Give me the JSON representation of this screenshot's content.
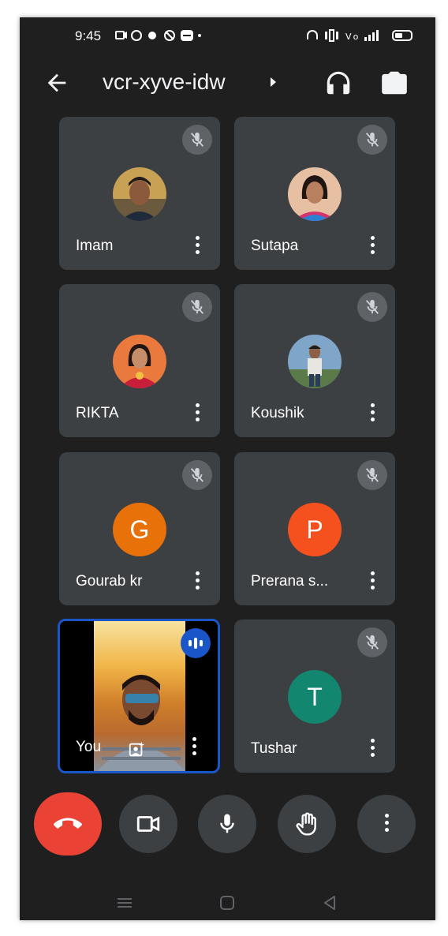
{
  "status_bar": {
    "time": "9:45"
  },
  "app_bar": {
    "meeting_code": "vcr-xyve-idw"
  },
  "participants": [
    {
      "name": "Imam",
      "muted": true,
      "avatar_type": "photo"
    },
    {
      "name": "Sutapa",
      "muted": true,
      "avatar_type": "photo"
    },
    {
      "name": "RIKTA",
      "muted": true,
      "avatar_type": "photo"
    },
    {
      "name": "Koushik",
      "muted": true,
      "avatar_type": "photo"
    },
    {
      "name": "Gourab kr",
      "muted": true,
      "avatar_type": "letter",
      "letter": "G",
      "color": "#e8710a"
    },
    {
      "name": "Prerana s...",
      "muted": true,
      "avatar_type": "letter",
      "letter": "P",
      "color": "#f4511e"
    },
    {
      "name": "You",
      "muted": false,
      "speaking": true,
      "avatar_type": "video"
    },
    {
      "name": "Tushar",
      "muted": true,
      "avatar_type": "letter",
      "letter": "T",
      "color": "#12866f"
    }
  ],
  "colors": {
    "background": "#1f1f20",
    "tile": "#3c4043",
    "hangup": "#ea4335",
    "active_speaker": "#1a56c8"
  },
  "controls": [
    "hang-up",
    "camera",
    "microphone",
    "raise-hand",
    "more-options"
  ],
  "icons": [
    "back-arrow-icon",
    "headphones-icon",
    "switch-camera-icon",
    "mic-off-icon",
    "more-vert-icon",
    "phone-hangup-icon",
    "videocam-icon",
    "mic-icon",
    "hand-icon",
    "menu-nav-icon",
    "home-nav-icon",
    "back-nav-icon"
  ]
}
